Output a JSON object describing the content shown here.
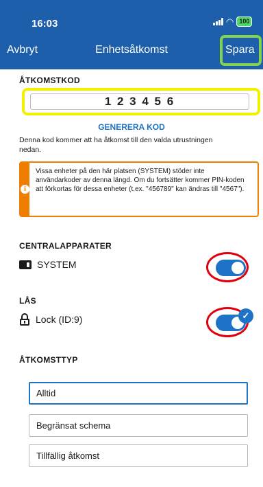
{
  "status_bar": {
    "time": "16:03",
    "battery": "100",
    "icons": [
      "signal-icon",
      "wifi-icon",
      "battery-icon"
    ]
  },
  "nav": {
    "cancel": "Avbryt",
    "title": "Enhetsåtkomst",
    "save": "Spara"
  },
  "access_code": {
    "section_label": "ÅTKOMSTKOD",
    "value": "123456",
    "display": "1 2 3 4 5 6",
    "generate_link": "GENERERA KOD",
    "description": "Denna kod kommer att ha åtkomst till den valda utrustningen nedan."
  },
  "warning": {
    "icon": "info-icon",
    "text": "Vissa enheter på den här platsen (SYSTEM) stöder inte användarkoder av denna längd. Om du fortsätter kommer PIN-koden att förkortas för dessa enheter (t.ex. \"456789\" kan ändras till \"4567\")."
  },
  "centrals": {
    "section_label": "CENTRALAPPARATER",
    "item_label": "SYSTEM",
    "icon": "control-panel-icon",
    "enabled": true
  },
  "locks": {
    "section_label": "LÅS",
    "item_label": "Lock (ID:9)",
    "icon": "lock-icon",
    "enabled": true
  },
  "access_type": {
    "section_label": "ÅTKOMSTTYP",
    "options": [
      "Alltid",
      "Begränsat schema",
      "Tillfällig åtkomst"
    ],
    "selected": "Alltid"
  },
  "colors": {
    "header": "#1d5faa",
    "accent": "#1e73c8",
    "warning": "#ef7d00",
    "highlight_yellow": "#f4f100",
    "highlight_green": "#84d34f",
    "highlight_red": "#e0000f"
  }
}
